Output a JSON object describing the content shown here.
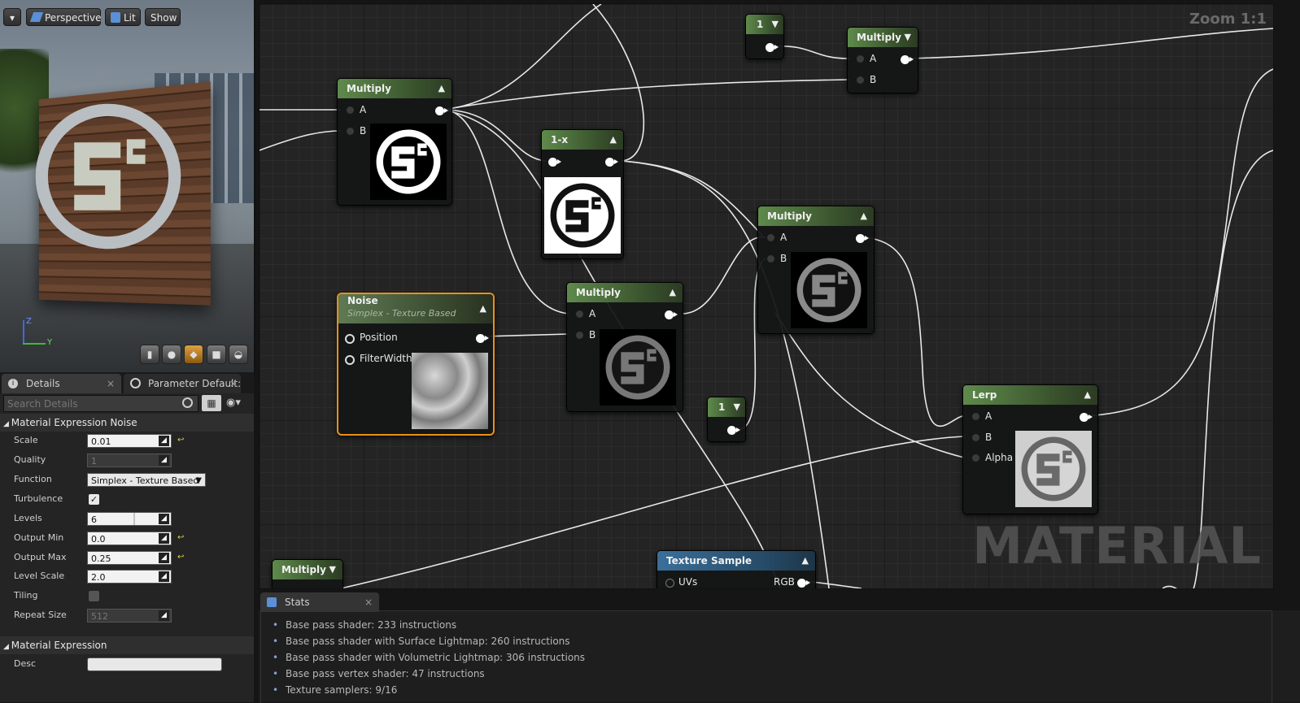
{
  "viewport": {
    "menu_label": "▾",
    "perspective_label": "Perspective",
    "lit_label": "Lit",
    "show_label": "Show",
    "axis_z": "Z",
    "axis_y": "Y"
  },
  "details": {
    "tabs": [
      {
        "label": "Details"
      },
      {
        "label": "Parameter Default:"
      }
    ],
    "search_placeholder": "Search Details",
    "section_noise": "Material Expression Noise",
    "properties": [
      {
        "label": "Scale",
        "value": "0.01"
      },
      {
        "label": "Quality",
        "value": "1"
      },
      {
        "label": "Function",
        "value": "Simplex - Texture Based"
      },
      {
        "label": "Turbulence",
        "value": "true"
      },
      {
        "label": "Levels",
        "value": "6"
      },
      {
        "label": "Output Min",
        "value": "0.0"
      },
      {
        "label": "Output Max",
        "value": "0.25"
      },
      {
        "label": "Level Scale",
        "value": "2.0"
      },
      {
        "label": "Tiling",
        "value": "false"
      },
      {
        "label": "Repeat Size",
        "value": "512"
      }
    ],
    "section_expression": "Material Expression",
    "desc_label": "Desc",
    "desc_value": ""
  },
  "graph": {
    "zoom": "Zoom 1:1",
    "watermark": "MATERIAL",
    "nodes": {
      "multiply1": {
        "title": "Multiply",
        "pins": [
          "A",
          "B"
        ]
      },
      "multiply2": {
        "title": "Multiply",
        "pins": [
          "A",
          "B"
        ]
      },
      "multiply3": {
        "title": "Multiply",
        "pins": [
          "A",
          "B"
        ]
      },
      "multiply4": {
        "title": "Multiply",
        "pins": [
          "A",
          "B"
        ]
      },
      "multiply5": {
        "title": "Multiply"
      },
      "one_minus": {
        "title": "1-x"
      },
      "const1": {
        "title": "1"
      },
      "const2": {
        "title": "1"
      },
      "noise": {
        "title": "Noise",
        "subtitle": "Simplex - Texture Based",
        "pins": [
          "Position",
          "FilterWidth"
        ]
      },
      "lerp": {
        "title": "Lerp",
        "pins": [
          "A",
          "B",
          "Alpha"
        ]
      },
      "texture_sample": {
        "title": "Texture Sample",
        "input": "UVs",
        "output": "RGB"
      }
    }
  },
  "stats": {
    "tab_label": "Stats",
    "lines": [
      "Base pass shader: 233 instructions",
      "Base pass shader with Surface Lightmap: 260 instructions",
      "Base pass shader with Volumetric Lightmap: 306 instructions",
      "Base pass vertex shader: 47 instructions",
      "Texture samplers: 9/16"
    ]
  }
}
